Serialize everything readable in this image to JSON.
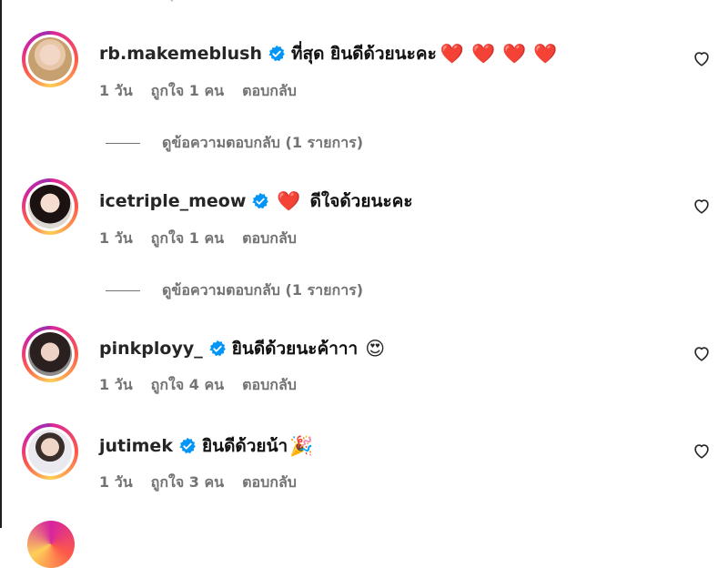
{
  "comments": [
    {
      "username": "rb.makemeblush",
      "text": "ที่สุด ยินดีด้วยนะคะ",
      "emojis": [
        "❤️",
        "❤️",
        "❤️",
        "❤️"
      ],
      "time": "1 วัน",
      "likes": "ถูกใจ 1 คน",
      "reply": "ตอบกลับ",
      "view_replies": "ดูข้อความตอบกลับ (1 รายการ)"
    },
    {
      "username": "icetriple_meow",
      "text": "ดีใจด้วยนะคะ",
      "emoji_before": "❤️",
      "time": "1 วัน",
      "likes": "ถูกใจ 1 คน",
      "reply": "ตอบกลับ",
      "view_replies": "ดูข้อความตอบกลับ (1 รายการ)"
    },
    {
      "username": "pinkployy_",
      "text": "ยินดีด้วยนะค้าาา",
      "emoji_after": "😍",
      "time": "1 วัน",
      "likes": "ถูกใจ 4 คน",
      "reply": "ตอบกลับ"
    },
    {
      "username": "jutimek",
      "text": "ยินดีด้วยน้า",
      "emoji_after": "🎉",
      "time": "1 วัน",
      "likes": "ถูกใจ 3 คน",
      "reply": "ตอบกลับ"
    }
  ],
  "colors": {
    "verified": "#0095f6",
    "ring_start": "#d6249f",
    "ring_end": "#fdcf58",
    "secondary_text": "#737373"
  },
  "icons": {
    "like": "heart-outline-icon",
    "verified": "verified-badge-icon"
  }
}
